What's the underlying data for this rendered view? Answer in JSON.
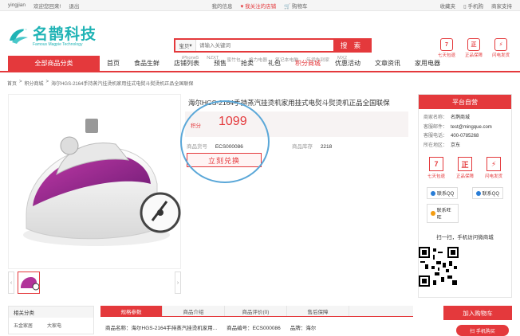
{
  "topbar": {
    "username": "yingjian",
    "welcome": "欢迎您回来!",
    "logout": "退出",
    "my_info": "我的信息",
    "fav_store": "我关注的店铺",
    "cart": "购物车",
    "favorites": "收藏夹",
    "mobile": "手机购",
    "seller": "商家支持"
  },
  "logo": {
    "cn": "名鹊科技",
    "en": "Famous Magpie Technology"
  },
  "search": {
    "scope": "宝贝",
    "placeholder": "请输入关键词",
    "button": "搜 索",
    "hot": [
      "iPhone5",
      "NZXT",
      "蜜竹包",
      "格力电器",
      "笔记本电脑",
      "年货先到家",
      "MX2"
    ]
  },
  "promises": [
    {
      "icon": "7",
      "label": "七天包退"
    },
    {
      "icon": "正",
      "label": "正品保障"
    },
    {
      "icon": "⚡",
      "label": "闪电发货"
    }
  ],
  "nav": {
    "all": "全部商品分类",
    "items": [
      "首页",
      "食品生鲜",
      "店铺列表",
      "预售",
      "抢卖",
      "礼包",
      "积分商城",
      "优惠活动",
      "文章资讯",
      "家用电器"
    ],
    "active_index": 6
  },
  "breadcrumb": [
    "首页",
    ">",
    "积分商城",
    ">",
    "海尔HGS-2164手持蒸汽挂烫机家用挂式电熨斗熨烫机正品全国联保"
  ],
  "product": {
    "title": "海尔HGS-2164手持蒸汽挂烫机家用挂式电熨斗熨烫机正品全国联保",
    "price_label": "积分",
    "price": "1099",
    "sku_label": "商品货号",
    "sku": "ECS000086",
    "stock_label": "商品库存",
    "stock": "2218",
    "redeem_button": "立刻兑换"
  },
  "store": {
    "header": "平台自营",
    "rows": [
      {
        "k": "商家名称：",
        "v": "名鹊商城"
      },
      {
        "k": "客服邮件：",
        "v": "test@mingque.com"
      },
      {
        "k": "客服电话：",
        "v": "400-0785268"
      },
      {
        "k": "所在地区：",
        "v": "京东"
      }
    ],
    "services": [
      {
        "icon": "7",
        "label": "七天包退"
      },
      {
        "icon": "正",
        "label": "正品保障"
      },
      {
        "icon": "⚡",
        "label": "闪电发货"
      }
    ],
    "qq1": "联系QQ",
    "qq2": "联系QQ",
    "wang": "联系旺旺",
    "scan": "扫一扫，手机访问微商城"
  },
  "left_cats": {
    "header": "相关分类",
    "items": [
      "五金家居",
      "大家电"
    ]
  },
  "tabs": [
    "规格参数",
    "商品介绍",
    "商品评价(0)",
    "售后保障"
  ],
  "spec": {
    "name_label": "商品名称：",
    "name": "海尔HGS-2164手持蒸汽挂烫机家用...",
    "code_label": "商品编号：",
    "code": "ECS000086",
    "brand_label": "品牌：",
    "brand": "海尔"
  },
  "cart_button": "加入购物车",
  "phone_buy": "扫 手机购买"
}
